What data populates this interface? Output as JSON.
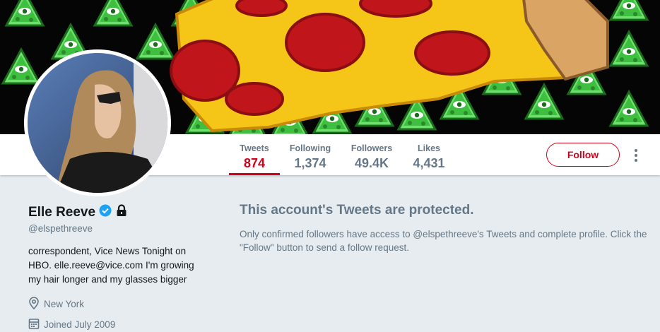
{
  "profile": {
    "name": "Elle Reeve",
    "handle": "@elspethreeve",
    "bio": "correspondent, Vice News Tonight on HBO. elle.reeve@vice.com I'm growing my hair longer and my glasses bigger",
    "location": "New York",
    "joined": "Joined July 2009",
    "verified": true,
    "protected": true
  },
  "stats": [
    {
      "label": "Tweets",
      "value": "874"
    },
    {
      "label": "Following",
      "value": "1,374"
    },
    {
      "label": "Followers",
      "value": "49.4K"
    },
    {
      "label": "Likes",
      "value": "4,431"
    }
  ],
  "actions": {
    "follow_label": "Follow"
  },
  "protected_notice": {
    "title": "This account's Tweets are protected.",
    "body": "Only confirmed followers have access to @elspethreeve's Tweets and complete profile. Click the \"Follow\" button to send a follow request."
  },
  "colors": {
    "accent": "#d0021b",
    "secondary_text": "#657786",
    "page_bg": "#e6ecf0",
    "verified": "#1da1f2"
  },
  "icons": {
    "verified": "verified-badge-icon",
    "lock": "lock-icon",
    "location": "location-pin-icon",
    "calendar": "calendar-icon",
    "more": "more-vertical-icon"
  }
}
